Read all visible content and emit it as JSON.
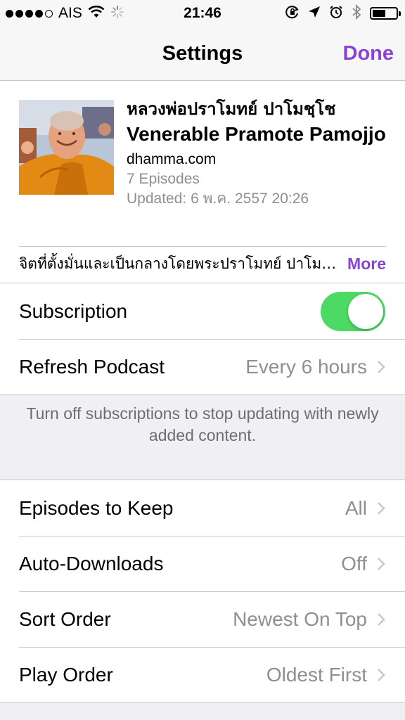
{
  "status_bar": {
    "carrier": "AIS",
    "time": "21:46",
    "signal_bars_filled": 4,
    "signal_bars_total": 5,
    "battery_level": 0.55
  },
  "nav": {
    "title": "Settings",
    "done_label": "Done"
  },
  "podcast": {
    "thai_title": "หลวงพ่อปราโมทย์ ปาโมชฺโช",
    "title": "Venerable Pramote Pamojjo",
    "author": "dhamma.com",
    "episodes": "7 Episodes",
    "updated": "Updated: 6 พ.ค. 2557 20:26",
    "description": "จิตที่ตั้งมั่นและเป็นกลางโดยพระปราโมทย์ ปาโมชฺโช",
    "more_label": "More"
  },
  "subscription": {
    "label": "Subscription",
    "enabled": true
  },
  "refresh": {
    "label": "Refresh Podcast",
    "value": "Every 6 hours"
  },
  "footer_note": "Turn off subscriptions to stop updating with newly added content.",
  "settings": [
    {
      "label": "Episodes to Keep",
      "value": "All"
    },
    {
      "label": "Auto-Downloads",
      "value": "Off"
    },
    {
      "label": "Sort Order",
      "value": "Newest On Top"
    },
    {
      "label": "Play Order",
      "value": "Oldest First"
    }
  ],
  "colors": {
    "accent": "#8a42d8",
    "toggle_on": "#4cd964",
    "secondary_text": "#8e8e93",
    "group_background": "#efeff4"
  },
  "icons": [
    "wifi-icon",
    "activity-spinner-icon",
    "rotation-lock-icon",
    "location-arrow-icon",
    "alarm-icon",
    "bluetooth-icon",
    "battery-icon",
    "chevron-right-icon"
  ]
}
